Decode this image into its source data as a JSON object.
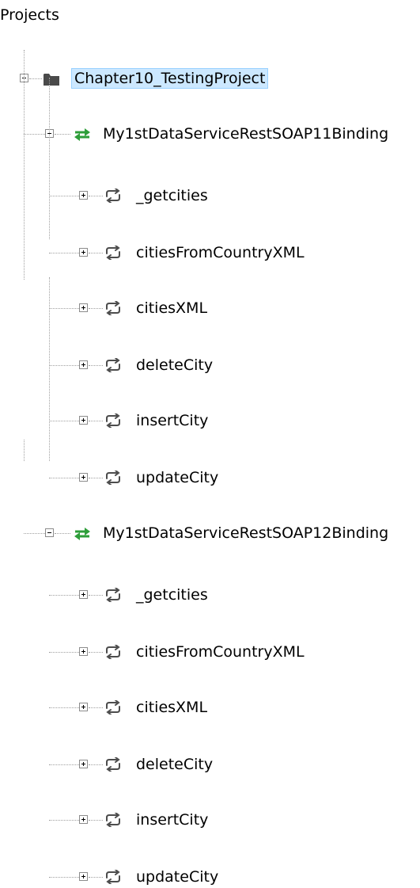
{
  "tree": {
    "root_label": "Projects",
    "project": {
      "label": "Chapter10_TestingProject",
      "icon": "folder-icon",
      "selected": true,
      "selection_color": "#cce8ff",
      "interfaces": [
        {
          "label": "My1stDataServiceRestSOAP11Binding",
          "icon": "interface-icon",
          "icon_color": "#2e9e3a",
          "operations": [
            "_getcities",
            "citiesFromCountryXML",
            "citiesXML",
            "deleteCity",
            "insertCity",
            "updateCity"
          ]
        },
        {
          "label": "My1stDataServiceRestSOAP12Binding",
          "icon": "interface-icon",
          "icon_color": "#2e9e3a",
          "operations": [
            "_getcities",
            "citiesFromCountryXML",
            "citiesXML",
            "deleteCity",
            "insertCity",
            "updateCity"
          ]
        }
      ]
    }
  }
}
